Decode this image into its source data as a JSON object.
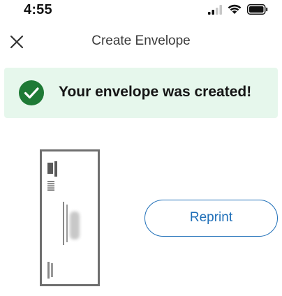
{
  "status_bar": {
    "time": "4:55",
    "icons": [
      "signal-icon",
      "wifi-icon",
      "battery-icon"
    ]
  },
  "nav": {
    "title": "Create Envelope",
    "close_icon": "close-icon"
  },
  "banner": {
    "message": "Your envelope was created!",
    "icon": "check-circle-icon",
    "background_color": "#e6f7ec",
    "icon_color": "#1e7a35"
  },
  "envelope": {
    "image": "envelope-preview"
  },
  "actions": {
    "reprint_label": "Reprint",
    "accent_color": "#1f6fb8"
  }
}
